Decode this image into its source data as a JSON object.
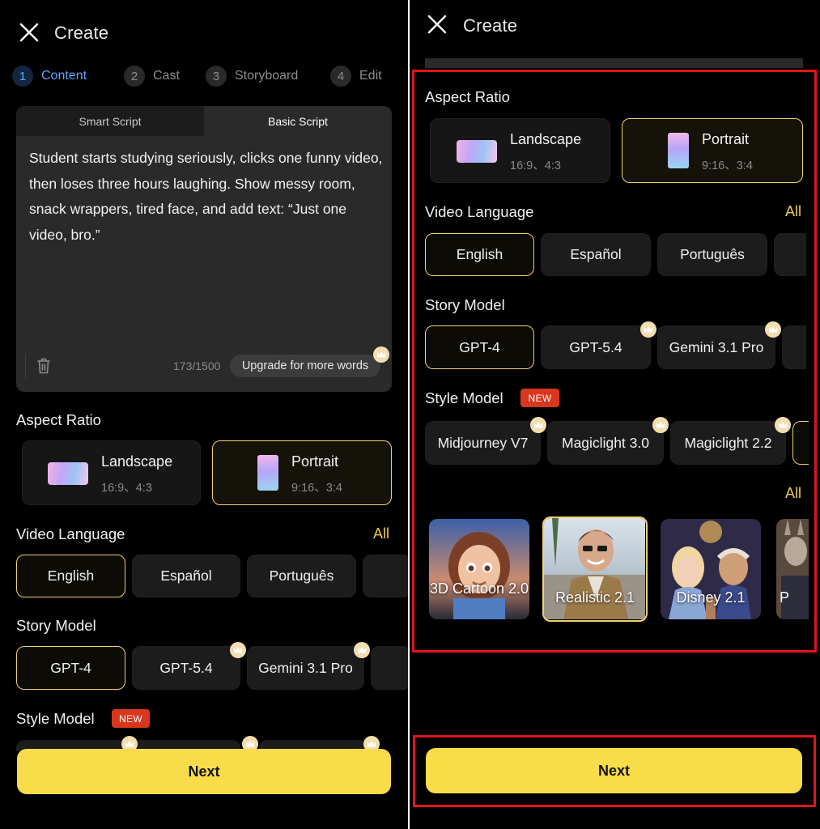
{
  "left": {
    "header": {
      "title": "Create"
    },
    "steps": [
      {
        "num": "1",
        "label": "Content"
      },
      {
        "num": "2",
        "label": "Cast"
      },
      {
        "num": "3",
        "label": "Storyboard"
      },
      {
        "num": "4",
        "label": "Edit"
      }
    ],
    "script": {
      "tabs": [
        "Smart Script",
        "Basic Script"
      ],
      "active_tab": "Basic Script",
      "text": "Student starts studying seriously, clicks one funny video, then loses three hours laughing. Show messy room, snack wrappers, tired face, and add text: “Just one video, bro.”",
      "count": "173/1500",
      "upgrade_label": "Upgrade for more words"
    },
    "aspect_ratio": {
      "title": "Aspect Ratio",
      "options": [
        {
          "name": "Landscape",
          "ratios": "16:9、4:3"
        },
        {
          "name": "Portrait",
          "ratios": "9:16、3:4",
          "selected": true
        }
      ]
    },
    "video_language": {
      "title": "Video Language",
      "all_label": "All",
      "options": [
        "English",
        "Español",
        "Português"
      ],
      "selected": "English"
    },
    "story_model": {
      "title": "Story Model",
      "options": [
        "GPT-4",
        "GPT-5.4",
        "Gemini 3.1 Pro"
      ],
      "selected": "GPT-4"
    },
    "style_model": {
      "title": "Style Model",
      "badge": "NEW"
    },
    "next_label": "Next"
  },
  "right": {
    "header": {
      "title": "Create"
    },
    "aspect_ratio": {
      "title": "Aspect Ratio",
      "options": [
        {
          "name": "Landscape",
          "ratios": "16:9、4:3"
        },
        {
          "name": "Portrait",
          "ratios": "9:16、3:4",
          "selected": true
        }
      ]
    },
    "video_language": {
      "title": "Video Language",
      "all_label": "All",
      "options": [
        "English",
        "Español",
        "Português"
      ],
      "selected": "English"
    },
    "story_model": {
      "title": "Story Model",
      "options": [
        "GPT-4",
        "GPT-5.4",
        "Gemini 3.1 Pro"
      ],
      "selected": "GPT-4"
    },
    "style_model": {
      "title": "Style Model",
      "badge": "NEW",
      "options": [
        "Midjourney V7",
        "Magiclight 3.0",
        "Magiclight 2.2"
      ]
    },
    "styles": {
      "all_label": "All",
      "items": [
        {
          "label": "3D Cartoon 2.0"
        },
        {
          "label": "Realistic 2.1",
          "selected": true
        },
        {
          "label": "Disney 2.1"
        },
        {
          "label": "P"
        }
      ]
    },
    "next_label": "Next"
  },
  "colors": {
    "accent_yellow": "#f8dc4a",
    "selected_border": "#f2d26b",
    "active_step_blue": "#5ea6ff",
    "new_badge_red": "#d9361e",
    "annotation_red": "#e0141c",
    "background": "#000000"
  },
  "icons": [
    "close-icon",
    "trash-icon",
    "crown-icon"
  ]
}
